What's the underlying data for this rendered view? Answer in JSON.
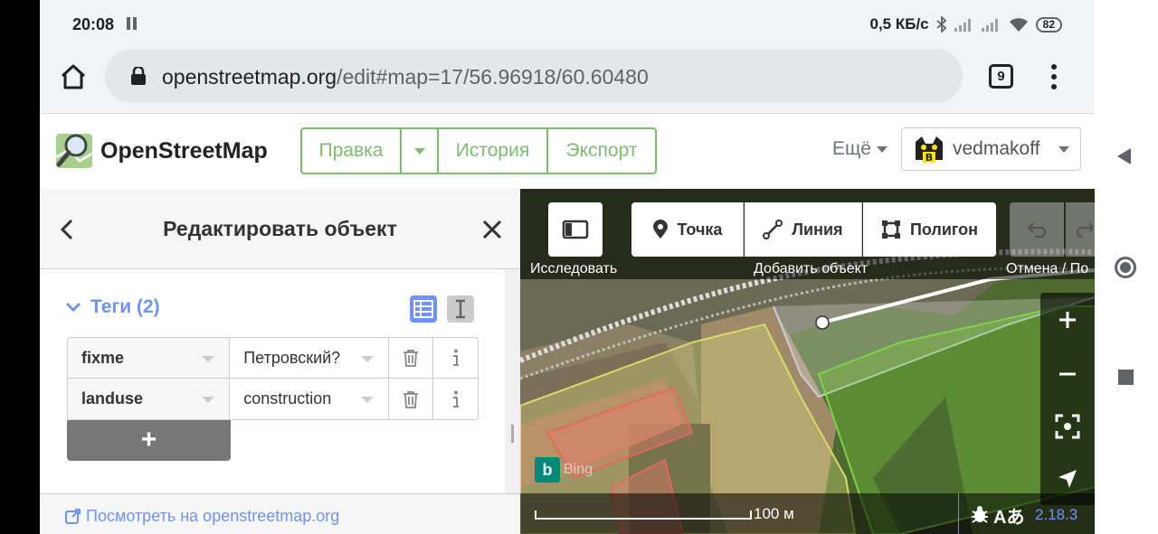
{
  "status_bar": {
    "time": "20:08",
    "net_speed": "0,5 КБ/с",
    "battery": "82"
  },
  "browser": {
    "url_host": "openstreetmap.org",
    "url_path": "/edit#map=17/56.96918/60.60480",
    "tab_count": "9"
  },
  "header": {
    "logo_text": "OpenStreetMap",
    "edit_label": "Правка",
    "history_label": "История",
    "export_label": "Экспорт",
    "more_label": "Ещё",
    "username": "vedmakoff"
  },
  "sidebar": {
    "title": "Редактировать объект",
    "tags_label": "Теги (2)",
    "tags": [
      {
        "key": "fixme",
        "value": "Петровский?"
      },
      {
        "key": "landuse",
        "value": "construction"
      }
    ],
    "add_label": "+",
    "view_link": "Посмотреть на openstreetmap.org"
  },
  "map": {
    "toolbar": {
      "point_label": "Точка",
      "line_label": "Линия",
      "area_label": "Полигон",
      "browse_caption": "Исследовать",
      "add_caption": "Добавить объект",
      "undo_caption": "Отмена / По"
    },
    "imagery_text": "Bing",
    "scale_label": "100 м",
    "version": "2.18.3"
  },
  "colors": {
    "osm_green": "#7ebc6f",
    "id_blue": "#7092ff"
  }
}
